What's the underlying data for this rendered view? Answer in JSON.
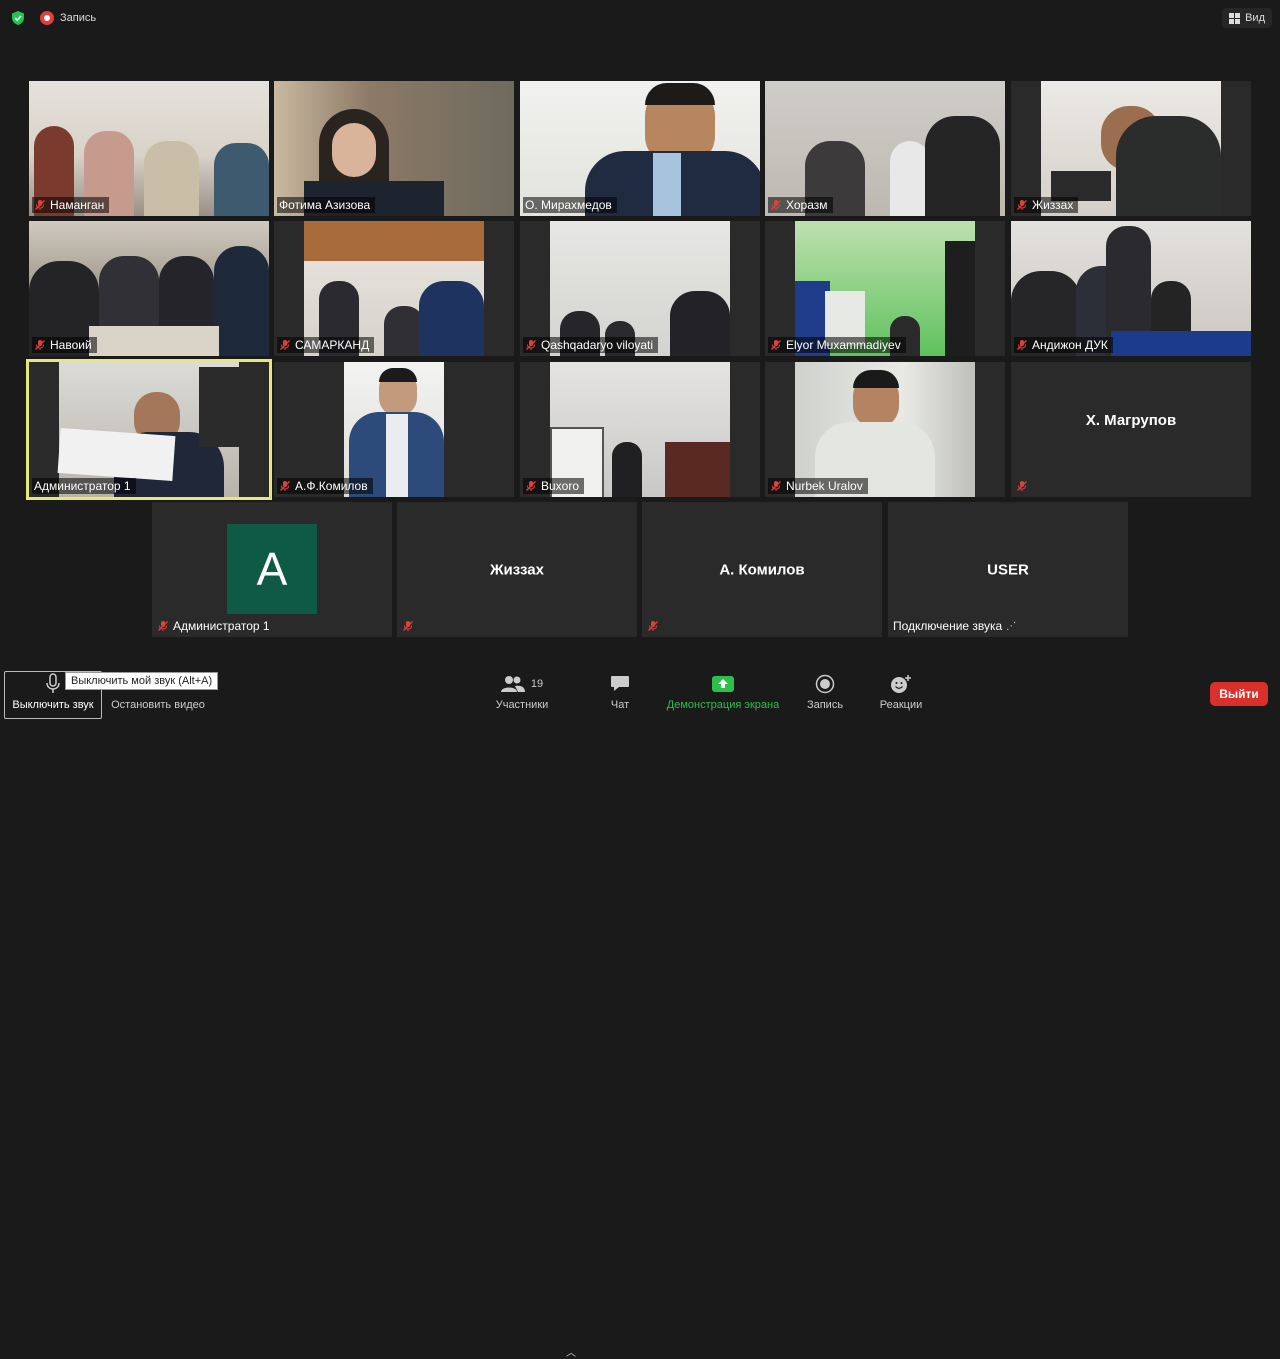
{
  "topbar": {
    "recording_label": "Запись",
    "view_label": "Вид"
  },
  "tiles": {
    "namangan": "Наманган",
    "azizova": "Фотима Азизова",
    "mirakhmedov": "О. Мирахмедов",
    "khorazm": "Хоразм",
    "jizzakh_video": "Жиззах",
    "navoiy": "Навоий",
    "samarkand": "САМАРКАНД",
    "qashqadaryo": "Qashqadaryo viloyati",
    "elyor": "Elyor Muxammadiyev",
    "andijon": "Андижон ДУК",
    "admin1": "Администратор 1",
    "komilov_af": "А.Ф.Комилов",
    "buxoro": "Buxoro",
    "nurbek": "Nurbek Uralov",
    "magrupov": "Х. Магрупов",
    "admin1_avatar_letter": "A",
    "admin1_avatar_label": "Администратор 1",
    "jizzakh": "Жиззах",
    "komilov_a": "А. Комилов",
    "user": "USER",
    "user_status": "Подключение звука"
  },
  "toolbar": {
    "mute_label": "Выключить звук",
    "mute_tooltip": "Выключить мой звук (Alt+A)",
    "stop_video_label": "Остановить видео",
    "participants_label": "Участники",
    "participants_count": "19",
    "chat_label": "Чат",
    "share_label": "Демонстрация экрана",
    "record_label": "Запись",
    "reactions_label": "Реакции",
    "exit_label": "Выйти"
  },
  "colors": {
    "share_green": "#2dbe4e",
    "exit_red": "#d9302c",
    "active_border": "#e6e67a",
    "avatar_bg": "#0e5a44"
  }
}
